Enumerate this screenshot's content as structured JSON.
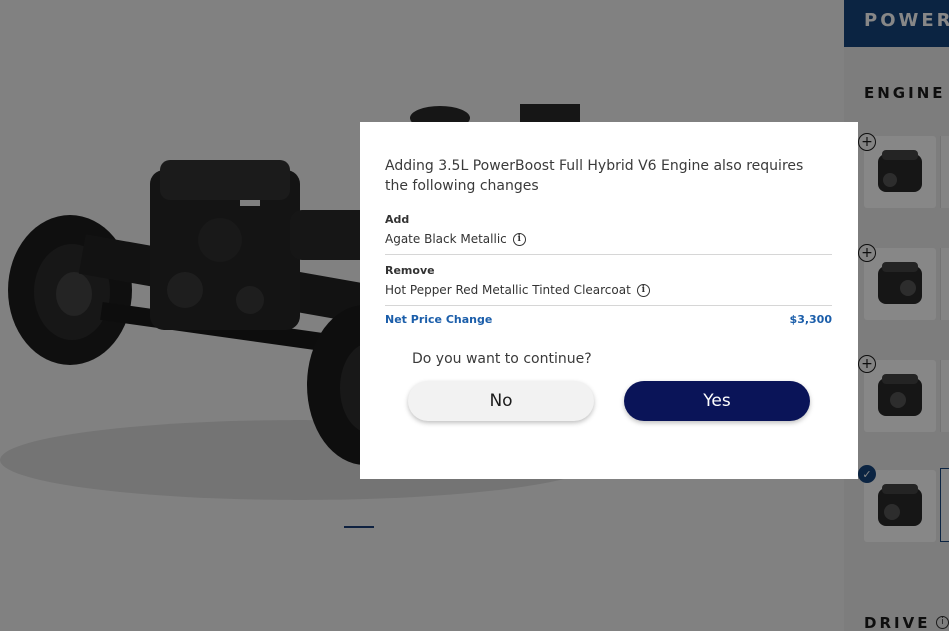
{
  "sidebar": {
    "header": "POWERT",
    "engine_label": "ENGINE",
    "drive_label": "DRIVE",
    "engine_options": [
      {
        "toggle": "+",
        "selected": false
      },
      {
        "toggle": "+",
        "selected": false
      },
      {
        "toggle": "+",
        "selected": false
      },
      {
        "toggle": "✓",
        "selected": true
      }
    ],
    "drive_info_glyph": "i"
  },
  "dialog": {
    "message": "Adding 3.5L PowerBoost Full Hybrid V6 Engine also requires the following changes",
    "add_label": "Add",
    "add_item": "Agate Black Metallic",
    "remove_label": "Remove",
    "remove_item": "Hot Pepper Red Metallic Tinted Clearcoat",
    "info_glyph": "i",
    "net_price_label": "Net Price Change",
    "net_price_value": "$3,300",
    "question": "Do you want to continue?",
    "no_label": "No",
    "yes_label": "Yes"
  },
  "colors": {
    "brand_blue": "#16457e",
    "yes_button": "#0a1458",
    "price_text": "#1b5eaa"
  }
}
